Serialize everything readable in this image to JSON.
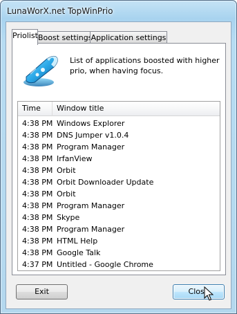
{
  "window": {
    "title": "LunaWorX.net TopWinPrio"
  },
  "tabs": [
    {
      "label": "Priolist",
      "active": true
    },
    {
      "label": "Boost settings",
      "active": false
    },
    {
      "label": "Application settings",
      "active": false
    }
  ],
  "panel": {
    "icon": "rocket-boost-icon",
    "description": "List of applications boosted with higher prio, when having focus."
  },
  "list": {
    "columns": [
      "Time",
      "Window title"
    ],
    "rows": [
      {
        "time": "4:38 PM",
        "title": "Windows Explorer"
      },
      {
        "time": "4:38 PM",
        "title": "DNS Jumper v1.0.4"
      },
      {
        "time": "4:38 PM",
        "title": "Program Manager"
      },
      {
        "time": "4:38 PM",
        "title": "IrfanView"
      },
      {
        "time": "4:38 PM",
        "title": "Orbit"
      },
      {
        "time": "4:38 PM",
        "title": "Orbit Downloader Update"
      },
      {
        "time": "4:38 PM",
        "title": "Orbit"
      },
      {
        "time": "4:38 PM",
        "title": "Program Manager"
      },
      {
        "time": "4:38 PM",
        "title": "Skype"
      },
      {
        "time": "4:38 PM",
        "title": "Program Manager"
      },
      {
        "time": "4:38 PM",
        "title": "HTML Help"
      },
      {
        "time": "4:38 PM",
        "title": "Google Talk"
      },
      {
        "time": "4:37 PM",
        "title": "Untitled - Google Chrome"
      }
    ]
  },
  "buttons": {
    "exit_label": "Exit",
    "close_label": "Close"
  },
  "colors": {
    "titlebar": "#a8d3ef",
    "close_button_highlight": "#bee6fd"
  }
}
